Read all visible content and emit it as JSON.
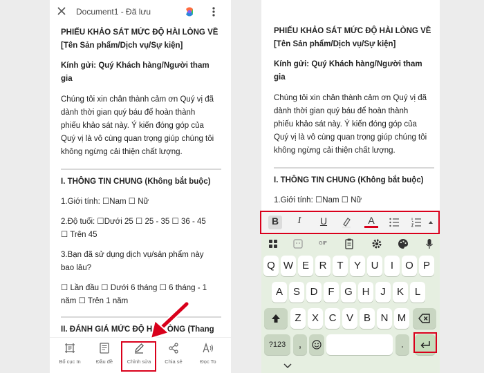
{
  "left": {
    "doc_title": "Document1 - Đã lưu",
    "content": {
      "heading_line1": "PHIẾU KHẢO SÁT MỨC ĐỘ HÀI LÒNG VỀ",
      "heading_line2": "[Tên Sản phẩm/Dịch vụ/Sự kiện]",
      "salutation_line1": "Kính gửi: Quý Khách hàng/Người tham",
      "salutation_line2": "gia",
      "intro_lines": [
        "Chúng tôi xin chân thành cảm ơn Quý vị đã",
        "dành thời gian quý báu để hoàn thành",
        "phiếu khảo sát này. Ý kiến đóng góp của",
        "Quý vị là vô cùng quan trọng giúp chúng tôi",
        "không ngừng cải thiện chất lượng."
      ],
      "section1": "I. THÔNG TIN CHUNG (Không bắt buộc)",
      "q1": "1.Giới tính: ☐Nam ☐ Nữ",
      "q2_line1": "2.Độ tuổi: ☐Dưới 25 ☐ 25 - 35 ☐ 36 - 45",
      "q2_line2": "☐ Trên 45",
      "q3_line1": "3.Bạn đã sử dụng dịch vụ/sản phẩm này",
      "q3_line2": "bao lâu?",
      "q3_opt_line1": "☐ Lần đầu ☐ Dưới 6 tháng ☐ 6 tháng - 1",
      "q3_opt_line2": "năm ☐ Trên 1 năm",
      "section2": "II. ĐÁNH GIÁ MỨC ĐỘ HÀI LÒNG (Thang"
    },
    "bottom_nav": [
      {
        "label": "Bố cục In"
      },
      {
        "label": "Đầu đề"
      },
      {
        "label": "Chỉnh sửa"
      },
      {
        "label": "Chia sẻ"
      },
      {
        "label": "Đọc To"
      }
    ]
  },
  "right": {
    "content": {
      "heading_line1": "PHIẾU KHẢO SÁT MỨC ĐỘ HÀI LÒNG VỀ",
      "heading_line2": "[Tên Sản phẩm/Dịch vụ/Sự kiện]",
      "salutation_line1": "Kính gửi: Quý Khách hàng/Người tham",
      "salutation_line2": "gia",
      "intro_lines": [
        "Chúng tôi xin chân thành cảm ơn Quý vị đã",
        "dành thời gian quý báu để hoàn thành",
        "phiếu khảo sát này. Ý kiến đóng góp của",
        "Quý vị là vô cùng quan trọng giúp chúng tôi",
        "không ngừng cải thiện chất lượng."
      ],
      "section1": "I. THÔNG TIN CHUNG (Không bắt buộc)",
      "q1": "1.Giới tính: ☐Nam ☐ Nữ"
    },
    "toolbar": {
      "bold": "B",
      "italic": "I",
      "underline": "U",
      "font_color": "A",
      "icons": [
        "highlighter-icon",
        "bullet-list-icon",
        "numbered-list-icon",
        "expand-up-icon"
      ]
    },
    "keyboard": {
      "gif_label": "GIF",
      "row1": [
        "Q",
        "W",
        "E",
        "R",
        "T",
        "Y",
        "U",
        "I",
        "O",
        "P"
      ],
      "row2": [
        "A",
        "S",
        "D",
        "F",
        "G",
        "H",
        "J",
        "K",
        "L"
      ],
      "row3": [
        "Z",
        "X",
        "C",
        "V",
        "B",
        "N",
        "M"
      ],
      "symbols_key": "?123",
      "comma_key": ",",
      "period_key": ".",
      "icons": [
        "apps-grid-icon",
        "sticker-icon",
        "clipboard-icon",
        "gear-icon",
        "palette-icon",
        "mic-icon",
        "shift-icon",
        "backspace-icon",
        "emoji-icon",
        "enter-icon",
        "chevron-down-icon"
      ]
    }
  },
  "colors": {
    "annotation_red": "#d9001b",
    "keyboard_bg": "#e6efe1",
    "font_color_underline": "#d9001b"
  }
}
